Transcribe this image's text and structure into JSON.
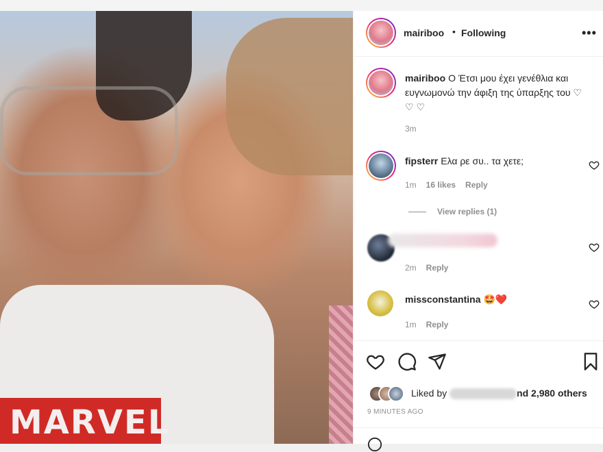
{
  "post": {
    "username": "mairiboo",
    "dot": "•",
    "follow_status": "Following",
    "more": "•••",
    "caption": "Ο Έτσι μου έχει γενέθλια και ευγνωμονώ την άφιξη της ύπαρξης του ♡ ♡ ♡",
    "caption_time": "3m",
    "photo_logo_text": "MARVEL"
  },
  "comments": [
    {
      "username": "fipsterr",
      "text": "Ελα ρε συ.. τα χετε;",
      "time": "1m",
      "likes": "16 likes",
      "reply": "Reply"
    },
    {
      "username": "",
      "text": "",
      "time": "2m",
      "reply": "Reply"
    },
    {
      "username": "missconstantina",
      "text": "🤩❤️",
      "time": "1m",
      "reply": "Reply"
    }
  ],
  "view_replies": "View replies (1)",
  "actions": {
    "like": "heart-icon",
    "comment": "comment-icon",
    "share": "send-icon",
    "save": "bookmark-icon"
  },
  "likes": {
    "prefix": "Liked by",
    "suffix": "nd 2,980 others"
  },
  "time_ago": "9 MINUTES AGO",
  "colors": {
    "accent_text": "#262626",
    "muted": "#8e8e8e",
    "border": "#efefef",
    "heart_red": "#ed4956"
  }
}
